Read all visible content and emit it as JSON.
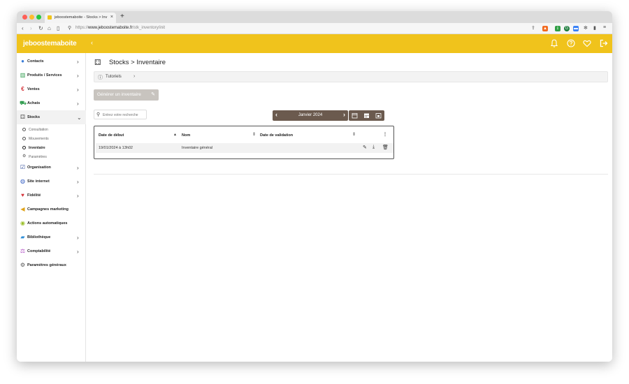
{
  "browser": {
    "tab_title": "jeboostemaboite - Stocks > Inv",
    "tab_close": "×",
    "new_tab": "+",
    "url_scheme": "https://",
    "url_host": "www.jeboostemaboite.fr",
    "url_path": "/stk_inventory/init"
  },
  "app": {
    "logo": "jeboostemaboite",
    "colors": {
      "header": "#f0c31c",
      "brown": "#6b5a4e",
      "disabled": "#c8c4bf"
    }
  },
  "sidebar": {
    "items": [
      {
        "label": "Contacts",
        "icon": "contacts-icon",
        "chevron": "›"
      },
      {
        "label": "Produits / Services",
        "icon": "products-icon",
        "chevron": "›"
      },
      {
        "label": "Ventes",
        "icon": "euro-icon",
        "chevron": "›"
      },
      {
        "label": "Achats",
        "icon": "cart-icon",
        "chevron": "›"
      },
      {
        "label": "Stocks",
        "icon": "boxes-icon",
        "chevron": "⌄"
      },
      {
        "label": "Organisation",
        "icon": "calendar-check-icon",
        "chevron": "›"
      },
      {
        "label": "Site internet",
        "icon": "globe-icon",
        "chevron": "›"
      },
      {
        "label": "Fidélité",
        "icon": "heart-icon",
        "chevron": "›"
      },
      {
        "label": "Campagnes marketing",
        "icon": "megaphone-icon",
        "chevron": ""
      },
      {
        "label": "Actions automatiques",
        "icon": "automation-icon",
        "chevron": ""
      },
      {
        "label": "Bibliothèque",
        "icon": "folder-icon",
        "chevron": "›"
      },
      {
        "label": "Comptabilité",
        "icon": "balance-icon",
        "chevron": "›"
      },
      {
        "label": "Paramètres généraux",
        "icon": "gear-icon",
        "chevron": ""
      }
    ],
    "stocks_sub": [
      {
        "label": "Consultation"
      },
      {
        "label": "Mouvements"
      },
      {
        "label": "Inventaire"
      },
      {
        "label": "Paramètres"
      }
    ]
  },
  "main": {
    "title_prefix": "Stocks",
    "title_sep": ">",
    "title": "Inventaire",
    "tutorials_label": "Tutoriels",
    "generate_button": "Générer un inventaire",
    "search_placeholder": "Entrez votre recherche",
    "month_label": "Janvier 2024",
    "table": {
      "columns": [
        "Date de début",
        "Nom",
        "Date de validation"
      ],
      "rows": [
        {
          "date": "19/01/2024 à 13h02",
          "name": "Inventaire général",
          "validation": ""
        }
      ]
    }
  }
}
